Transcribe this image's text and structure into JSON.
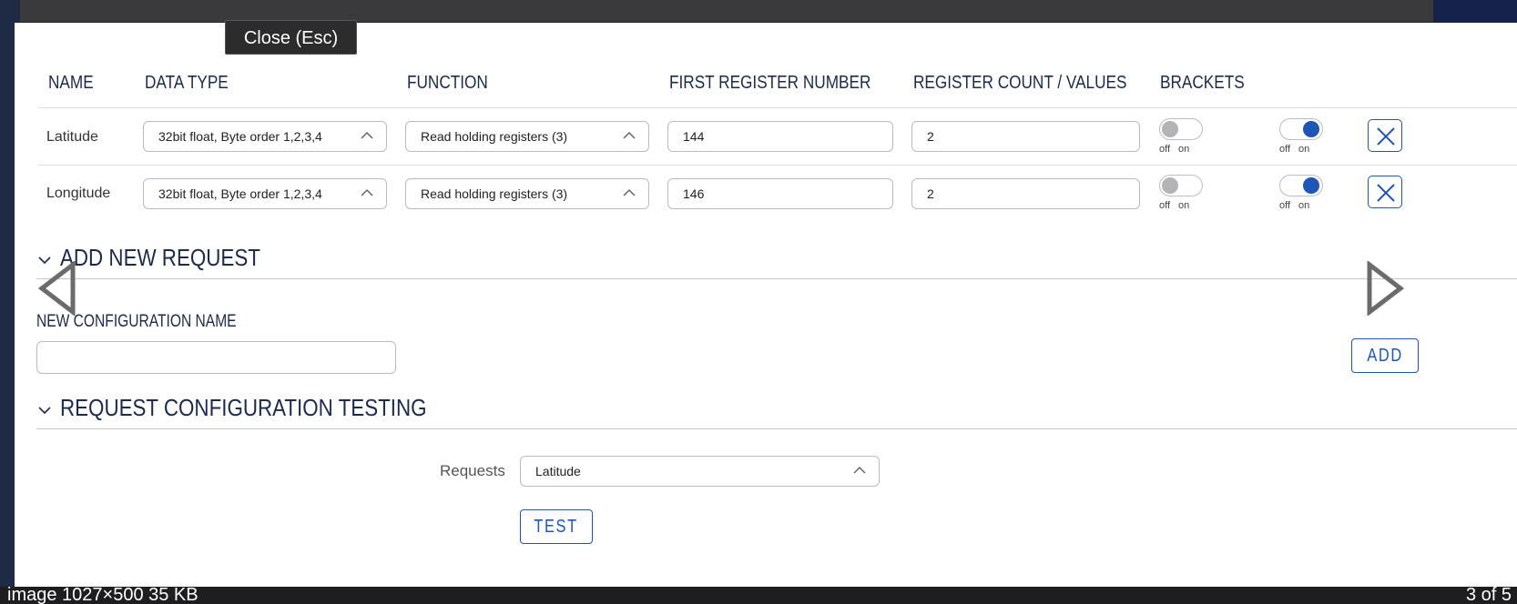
{
  "tooltip": "Close (Esc)",
  "table": {
    "headers": [
      "NAME",
      "DATA TYPE",
      "FUNCTION",
      "FIRST REGISTER NUMBER",
      "REGISTER COUNT / VALUES",
      "BRACKETS"
    ],
    "rows": [
      {
        "name": "Latitude",
        "data_type": "32bit float, Byte order 1,2,3,4",
        "function": "Read holding registers (3)",
        "first_register": "144",
        "register_count": "2",
        "brackets_toggle": "off",
        "enabled_toggle": "on"
      },
      {
        "name": "Longitude",
        "data_type": "32bit float, Byte order 1,2,3,4",
        "function": "Read holding registers (3)",
        "first_register": "146",
        "register_count": "2",
        "brackets_toggle": "off",
        "enabled_toggle": "on"
      }
    ],
    "toggle_off_label": "off",
    "toggle_on_label": "on"
  },
  "add_new_request": {
    "title": "ADD NEW REQUEST",
    "field_label": "NEW CONFIGURATION NAME",
    "field_value": "",
    "add_button": "ADD"
  },
  "testing": {
    "title": "REQUEST CONFIGURATION TESTING",
    "requests_label": "Requests",
    "requests_value": "Latitude",
    "test_button": "TEST"
  },
  "background": {
    "bottom_text": "image   1027×500  35 KB",
    "counter": "3 of 5"
  },
  "colors": {
    "accent": "#1e56b8",
    "heading": "#1c2a4d",
    "border": "#b9bcc4"
  }
}
